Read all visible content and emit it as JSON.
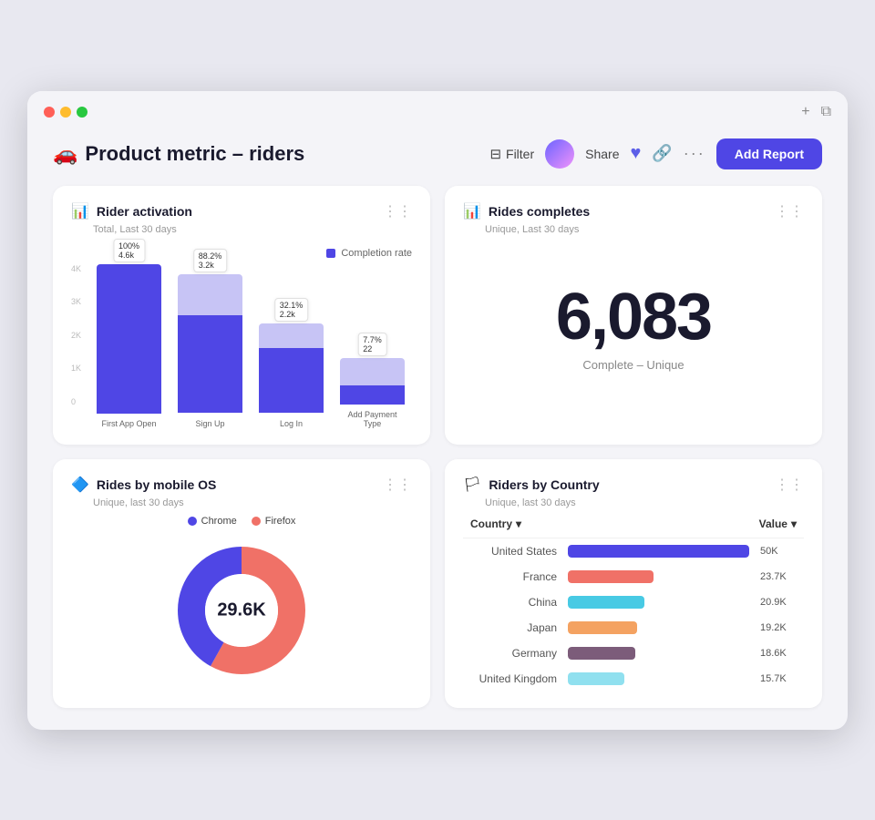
{
  "window": {
    "titlebar": {
      "plus_icon": "+",
      "copy_icon": "⧉"
    }
  },
  "page": {
    "title_emoji": "🚗",
    "title": "Product metric – riders",
    "actions": {
      "filter_label": "Filter",
      "share_label": "Share",
      "add_report_label": "Add Report"
    }
  },
  "rider_activation": {
    "title": "Rider activation",
    "subtitle": "Total, Last 30 days",
    "legend": "Completion rate",
    "bars": [
      {
        "label": "First App Open",
        "bottom_pct": 100,
        "top_pct": 0,
        "tooltip1": "100%",
        "tooltip2": "4.6k"
      },
      {
        "label": "Sign Up",
        "bottom_pct": 66,
        "top_pct": 22,
        "tooltip1": "88.2%",
        "tooltip2": "3.2k"
      },
      {
        "label": "Log In",
        "bottom_pct": 38,
        "top_pct": 15,
        "tooltip1": "32.1%",
        "tooltip2": "2.2k"
      },
      {
        "label": "Add Payment Type",
        "bottom_pct": 8,
        "top_pct": 15,
        "tooltip1": "7.7%",
        "tooltip2": "22"
      }
    ]
  },
  "rides_completes": {
    "title": "Rides completes",
    "subtitle": "Unique, Last 30 days",
    "number": "6,083",
    "label": "Complete – Unique"
  },
  "rides_by_os": {
    "title": "Rides by mobile OS",
    "subtitle": "Unique, last 30 days",
    "total": "29.6K",
    "legend": [
      {
        "label": "Chrome",
        "color": "#4f46e5"
      },
      {
        "label": "Firefox",
        "color": "#f07167"
      }
    ],
    "chrome_pct": 42,
    "firefox_pct": 58
  },
  "riders_by_country": {
    "title": "Riders by Country",
    "subtitle": "Unique, last 30 days",
    "col_country": "Country",
    "col_value": "Value",
    "rows": [
      {
        "name": "United States",
        "value": "50K",
        "bar_pct": 100,
        "color": "#4f46e5"
      },
      {
        "name": "France",
        "value": "23.7K",
        "bar_pct": 47,
        "color": "#f07167"
      },
      {
        "name": "China",
        "value": "20.9K",
        "bar_pct": 42,
        "color": "#48cae4"
      },
      {
        "name": "Japan",
        "value": "19.2K",
        "bar_pct": 38,
        "color": "#f4a261"
      },
      {
        "name": "Germany",
        "value": "18.6K",
        "bar_pct": 37,
        "color": "#7c5c7a"
      },
      {
        "name": "United Kingdom",
        "value": "15.7K",
        "bar_pct": 31,
        "color": "#90e0ef"
      }
    ]
  }
}
